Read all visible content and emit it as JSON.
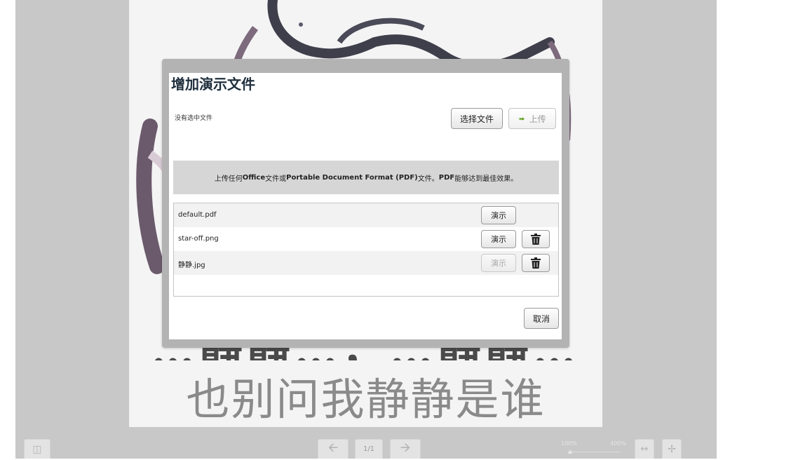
{
  "slide": {
    "caption_line1": "…静静…，…静静…",
    "caption_line2": "也别问我静静是谁"
  },
  "modal": {
    "title": "增加演示文件",
    "no_file_selected": "没有选中文件",
    "choose_file_label": "选择文件",
    "upload_label": "上传",
    "info_prefix": "上传任何",
    "info_office": "Office",
    "info_middle": "文件或",
    "info_pdf_name": "Portable Document Format (PDF)",
    "info_suffix1": "文件。",
    "info_pdf": "PDF",
    "info_suffix2": "能够达到最佳效果。",
    "files": [
      {
        "name": "default.pdf",
        "present_label": "演示",
        "present_enabled": true,
        "deletable": false
      },
      {
        "name": "star-off.png",
        "present_label": "演示",
        "present_enabled": true,
        "deletable": true
      },
      {
        "name": "静静.jpg",
        "present_label": "演示",
        "present_enabled": false,
        "deletable": true
      }
    ],
    "cancel_label": "取消"
  },
  "toolbar": {
    "page_indicator": "1/1",
    "zoom_min": "100%",
    "zoom_max": "400%",
    "zoom_level": 1.0
  },
  "colors": {
    "background": "#c8c8c8",
    "modal_frame": "#b3b3b3",
    "info_box": "#d6d6d6",
    "upload_arrow": "#6aa428"
  }
}
